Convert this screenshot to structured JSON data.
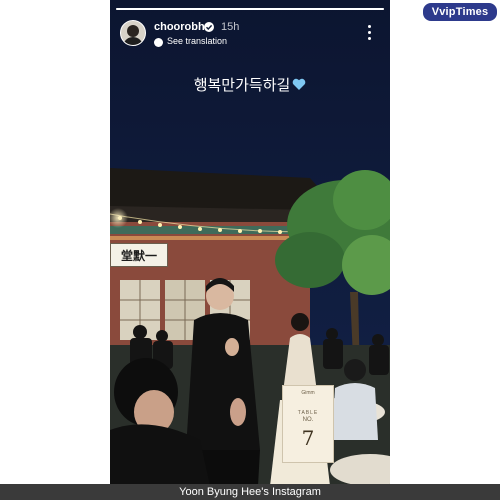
{
  "watermark": {
    "label": "VvipTimes"
  },
  "story": {
    "progress": 1.0,
    "username": "choorobh",
    "verified": true,
    "time_ago": "15h",
    "translate_label": "See translation",
    "caption": "행복만가득하길",
    "caption_emoji": "blue-heart-icon",
    "photo": {
      "signboard_text": "堂默一",
      "table_card": {
        "top_label": "Gimm",
        "table_label": "TABLE",
        "no_label": "NO.",
        "number": "7"
      }
    }
  },
  "credit": {
    "text": "Yoon Byung Hee's Instagram"
  },
  "colors": {
    "badge": "#2d3a8c",
    "sky": "#0f1a35",
    "credit_bar": "#3a3a3a"
  }
}
